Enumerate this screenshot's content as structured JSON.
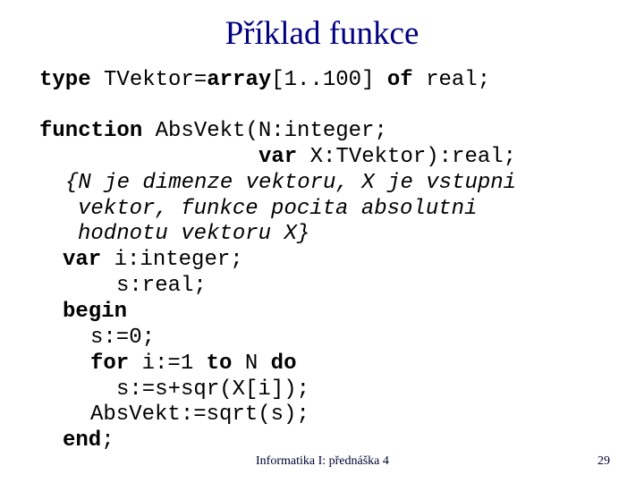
{
  "slide": {
    "title": "Příklad funkce",
    "code": {
      "l1": {
        "kw1": "type",
        "t1": " TVektor=",
        "kw2": "array",
        "t2": "[1..100] ",
        "kw3": "of",
        "t3": " real;"
      },
      "l2": {
        "kw1": "function",
        "t1": " AbsVekt(N:integer;"
      },
      "l3": {
        "kw1": "var",
        "t1": " X:TVektor):real;"
      },
      "l4": {
        "c": "{N je dimenze vektoru, X je vstupni"
      },
      "l5": {
        "c": "vektor, funkce pocita absolutni"
      },
      "l6": {
        "c": "hodnotu vektoru X}"
      },
      "l7": {
        "kw1": "var",
        "t1": " i:integer;"
      },
      "l8": {
        "t1": "s:real;"
      },
      "l9": {
        "kw1": "begin"
      },
      "l10": {
        "t1": "s:=0;"
      },
      "l11": {
        "kw1": "for",
        "t1": " i:=1 ",
        "kw2": "to",
        "t2": " N ",
        "kw3": "do"
      },
      "l12": {
        "t1": "s:=s+sqr(X[i]);"
      },
      "l13": {
        "t1": "AbsVekt:=sqrt(s);"
      },
      "l14": {
        "kw1": "end",
        "t1": ";"
      }
    },
    "footer": {
      "course": "Informatika I: přednáška 4",
      "page_number": "29"
    },
    "colors": {
      "title": "#000080",
      "code": "#000000"
    }
  }
}
